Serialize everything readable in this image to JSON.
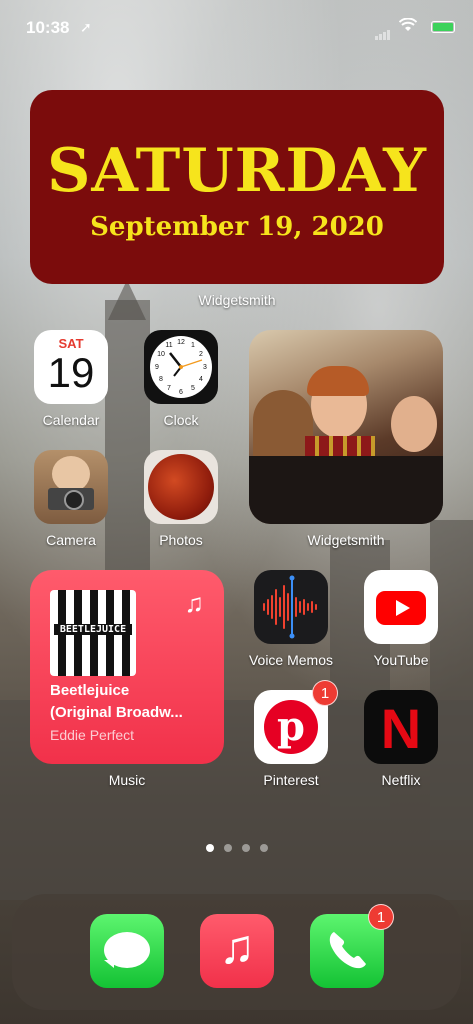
{
  "status_bar": {
    "time": "10:38",
    "location_arrow": "location-arrow-icon"
  },
  "date_widget": {
    "day": "SATURDAY",
    "date": "September 19, 2020",
    "label": "Widgetsmith",
    "bg_color": "#7b0c0c",
    "text_color": "#f6e41c"
  },
  "apps": {
    "calendar": {
      "label": "Calendar",
      "weekday": "SAT",
      "day": "19"
    },
    "clock": {
      "label": "Clock"
    },
    "camera": {
      "label": "Camera"
    },
    "photos": {
      "label": "Photos"
    },
    "photo_widget": {
      "label": "Widgetsmith"
    },
    "voice_memos": {
      "label": "Voice Memos"
    },
    "youtube": {
      "label": "YouTube"
    },
    "pinterest": {
      "label": "Pinterest",
      "badge": "1"
    },
    "netflix": {
      "label": "Netflix",
      "logo": "N"
    }
  },
  "music_widget": {
    "title": "Beetlejuice",
    "subtitle": "(Original Broadw...",
    "artist": "Eddie Perfect",
    "label": "Music",
    "album_art_text": "BEETLEJUICE"
  },
  "page_dots": {
    "count": 4,
    "active": 0
  },
  "dock": {
    "messages": {
      "icon": "messages-icon"
    },
    "music": {
      "icon": "music-note-icon"
    },
    "phone": {
      "icon": "phone-icon",
      "badge": "1"
    }
  }
}
